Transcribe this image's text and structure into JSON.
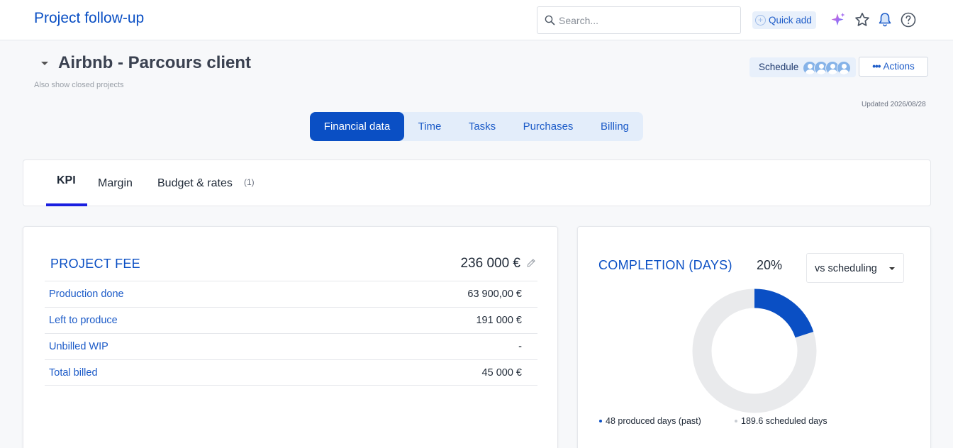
{
  "app": {
    "title": "Project follow-up"
  },
  "search": {
    "placeholder": "Search..."
  },
  "quick_add": {
    "label": "Quick add"
  },
  "project": {
    "name": "Airbnb - Parcours client",
    "show_closed": "Also show closed projects",
    "updated": "Updated 2026/08/28"
  },
  "header_buttons": {
    "schedule": "Schedule",
    "actions": "Actions",
    "avatar_count": 4
  },
  "main_tabs": [
    {
      "label": "Financial data",
      "active": true
    },
    {
      "label": "Time",
      "active": false
    },
    {
      "label": "Tasks",
      "active": false
    },
    {
      "label": "Purchases",
      "active": false
    },
    {
      "label": "Billing",
      "active": false
    }
  ],
  "sub_tabs": [
    {
      "label": "KPI",
      "active": true
    },
    {
      "label": "Margin",
      "active": false
    },
    {
      "label": "Budget & rates",
      "count": "(1)",
      "active": false
    }
  ],
  "project_fee": {
    "title": "PROJECT FEE",
    "total": "236 000 €",
    "rows": [
      {
        "label": "Production done",
        "value": "63 900,00 €"
      },
      {
        "label": "Left to produce",
        "value": "191 000 €"
      },
      {
        "label": "Unbilled WIP",
        "value": "-"
      },
      {
        "label": "Total billed",
        "value": "45 000 €"
      }
    ]
  },
  "completion": {
    "title": "COMPLETION (DAYS)",
    "percent": "20%",
    "percent_value": 20,
    "select_value": "vs scheduling",
    "legend": [
      {
        "label": "48 produced days (past)",
        "color": "#0a4fc4"
      },
      {
        "label": "189.6 scheduled days",
        "color": "#c8ccd2"
      }
    ]
  },
  "colors": {
    "primary": "#0a4fc4",
    "track": "#e9eaec",
    "accent_underline": "#1a1fe0"
  }
}
